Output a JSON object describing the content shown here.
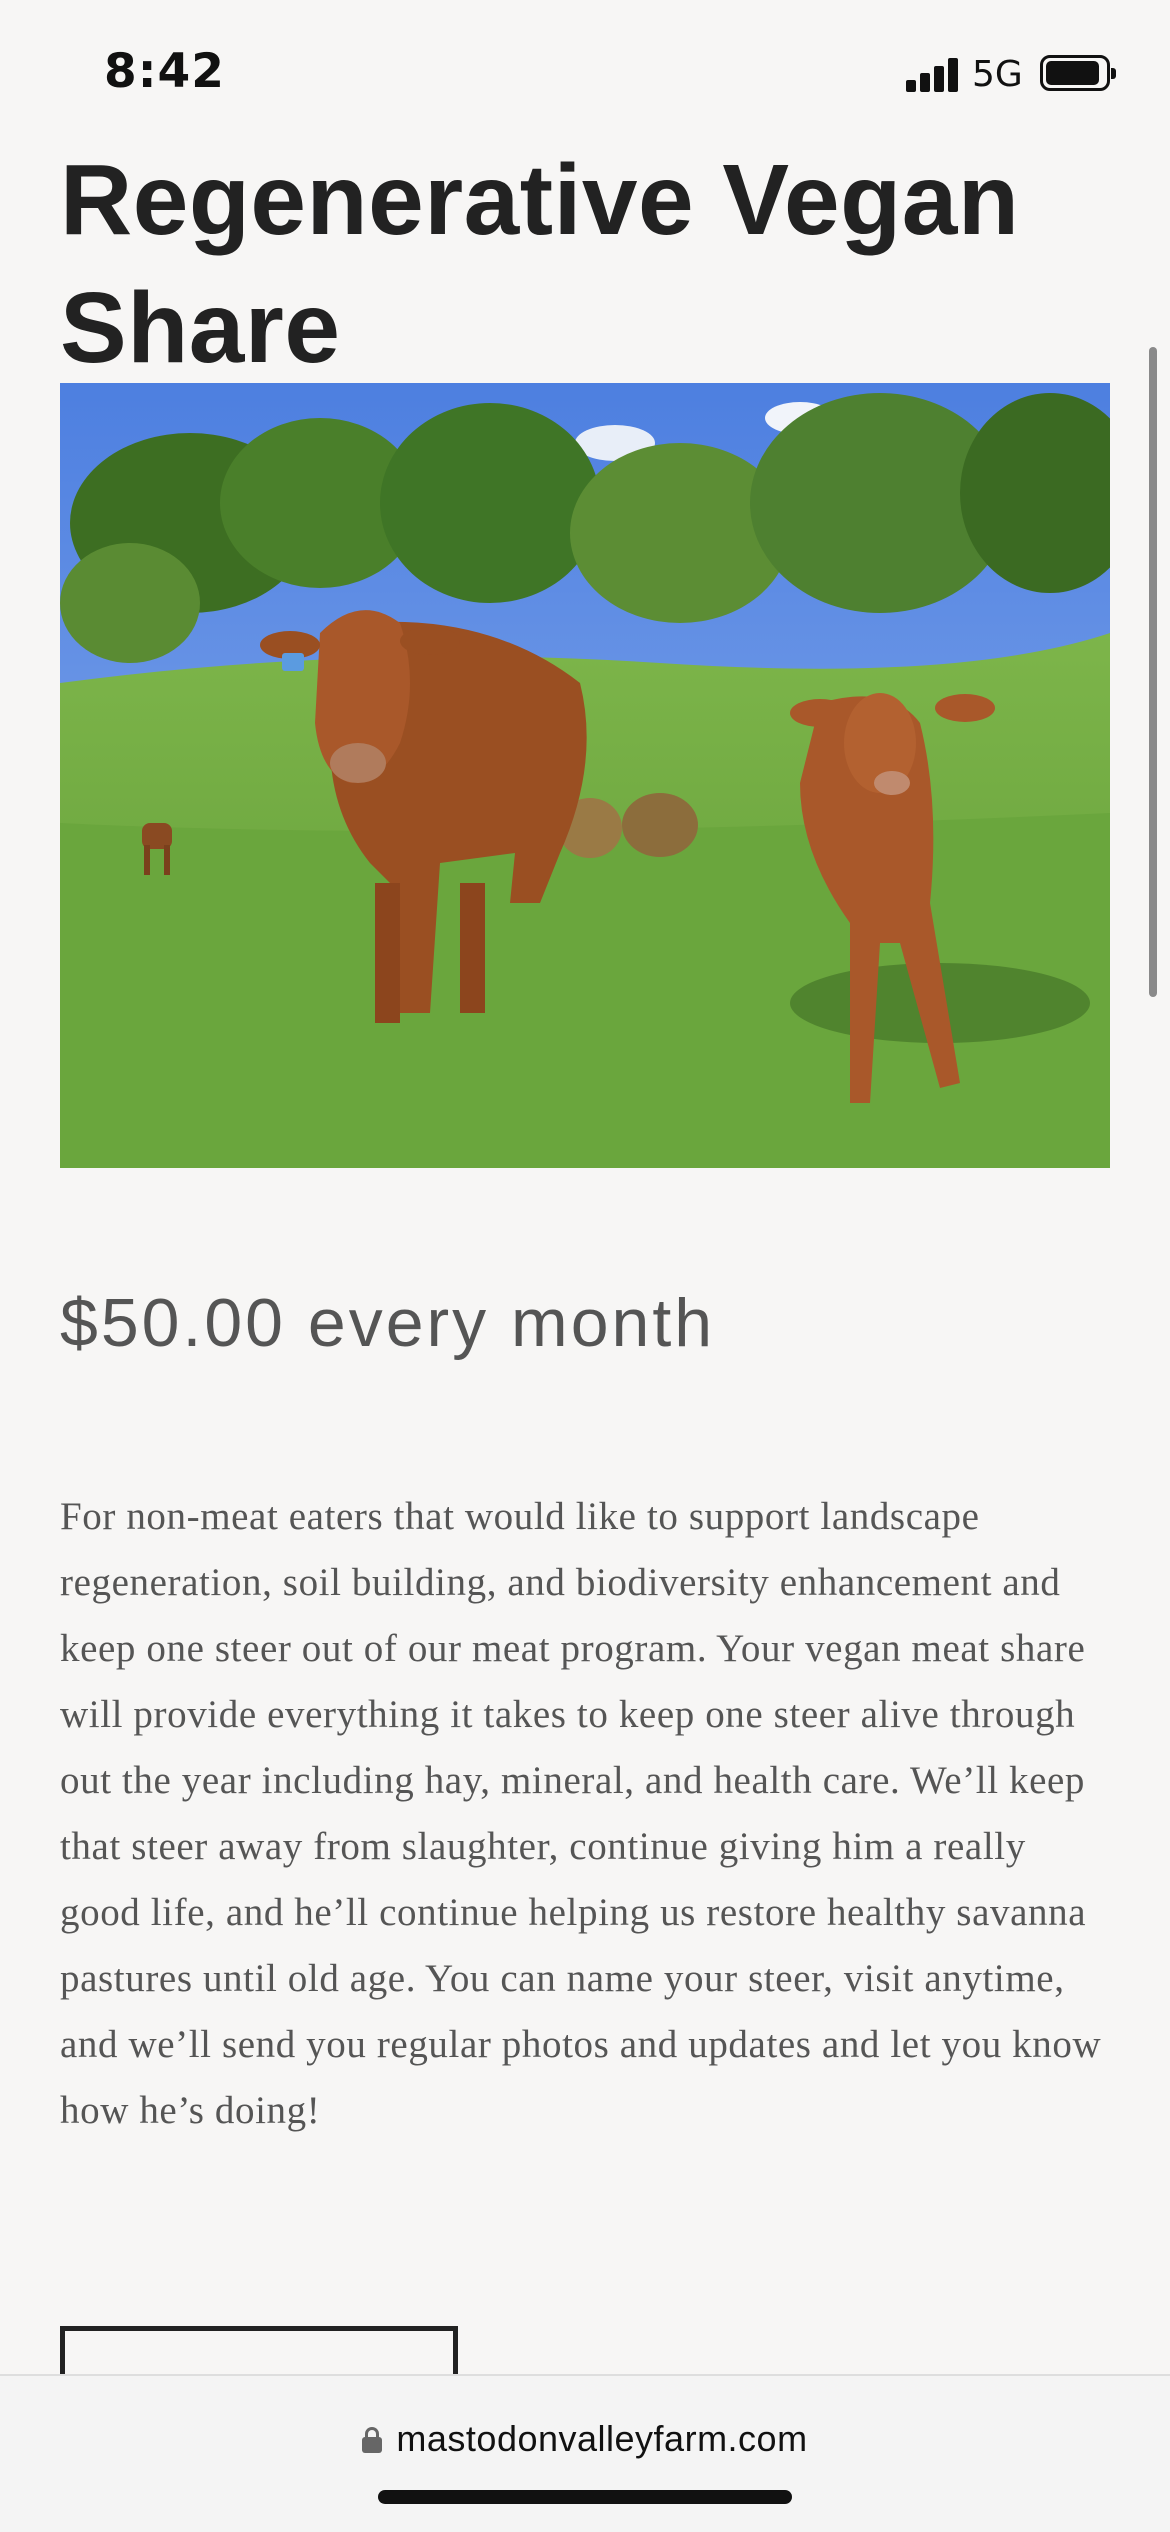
{
  "status_bar": {
    "time": "8:42",
    "network": "5G",
    "icons": [
      "signal-bars-icon",
      "battery-icon"
    ]
  },
  "product": {
    "title": "Regenerative Vegan Share",
    "image_icon": "cattle-pasture-photo",
    "price": "$50.00 every month",
    "description": "For non-meat eaters that would like to support landscape regeneration, soil building, and biodiversity enhancement and keep one steer out of our meat program. Your vegan meat share will provide everything it takes to keep one steer alive through out the year including hay, mineral, and health care. We’ll keep that steer away from slaughter, continue giving him a really good life, and he’ll continue helping us restore healthy savanna pastures until old age. You can name your steer, visit anytime, and we’ll send you regular photos and updates and let you know how he’s doing!"
  },
  "browser": {
    "url": "mastodonvalleyfarm.com",
    "url_icon": "lock-icon"
  },
  "colors": {
    "background": "#f7f6f5",
    "title": "#222222",
    "body_text": "#555555"
  }
}
